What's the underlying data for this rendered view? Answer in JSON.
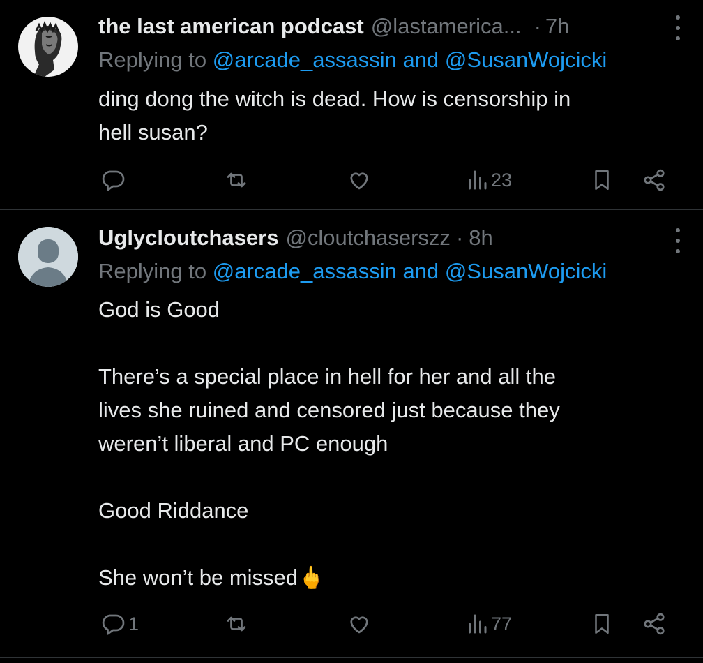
{
  "tweets": [
    {
      "author_name": "the last american podcast",
      "author_handle": "@lastamerica...",
      "separator": "·",
      "time": "7h",
      "replying_prefix": "Replying to",
      "replying_to_1": "@arcade_assassin",
      "replying_and": "and",
      "replying_to_2": "@SusanWojcicki",
      "body": [
        "ding dong the witch is dead. How is censorship in",
        "hell susan?"
      ],
      "reply_count": "",
      "retweet_count": "",
      "like_count": "",
      "view_count": "23"
    },
    {
      "author_name": "Uglycloutchasers",
      "author_handle": "@cloutchaserszz",
      "separator": "·",
      "time": "8h",
      "replying_prefix": "Replying to",
      "replying_to_1": "@arcade_assassin",
      "replying_and": "and",
      "replying_to_2": "@SusanWojcicki",
      "body": [
        "God is Good",
        "",
        "There’s a special place in hell for her and all the",
        "lives she ruined and censored just because they",
        "weren’t liberal and PC enough",
        "",
        "Good Riddance",
        "",
        "She won’t be missed🖕"
      ],
      "reply_count": "1",
      "retweet_count": "",
      "like_count": "",
      "view_count": "77"
    }
  ],
  "icons": {
    "reply": "reply-icon",
    "retweet": "retweet-icon",
    "like": "heart-icon",
    "views": "views-icon",
    "bookmark": "bookmark-icon",
    "share": "share-icon",
    "more": "more-icon"
  },
  "colors": {
    "background": "#000000",
    "text": "#e7e9ea",
    "secondary": "#71767b",
    "mention": "#1d9bf0",
    "divider": "#2f3336"
  }
}
